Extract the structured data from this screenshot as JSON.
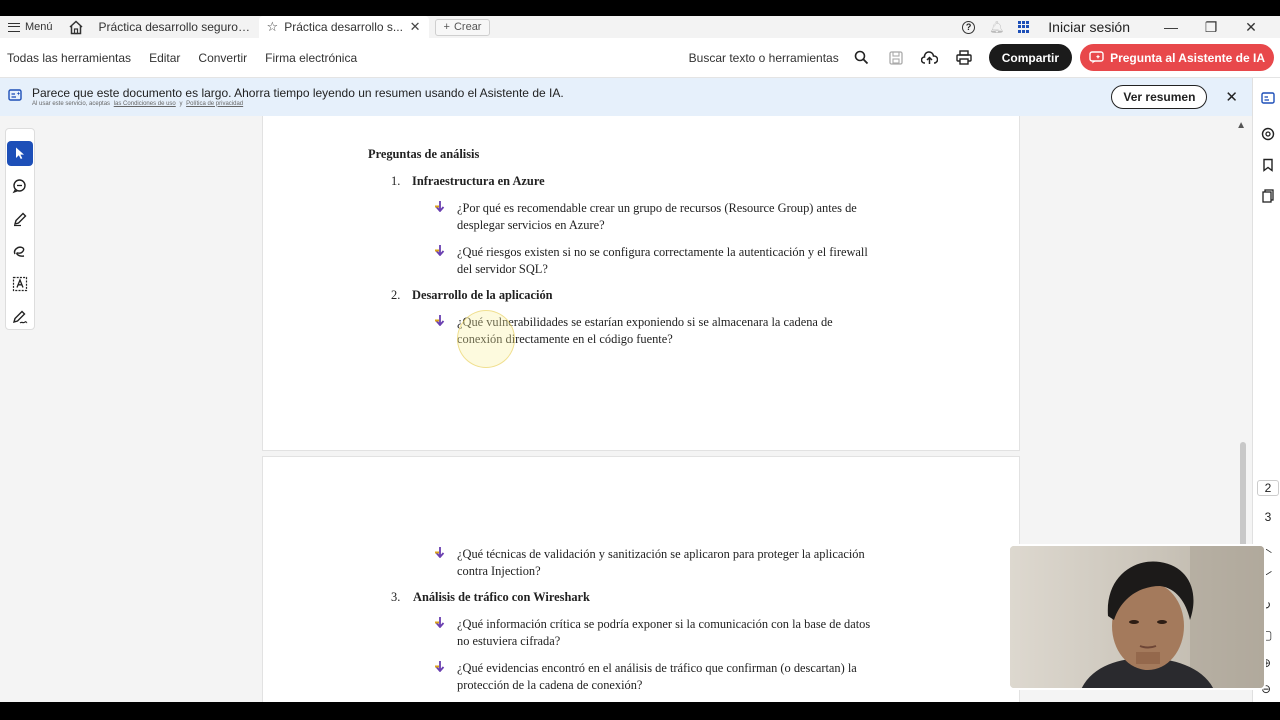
{
  "tabbar": {
    "menu_label": "Menú",
    "tabs": [
      {
        "label": "Práctica desarrollo seguro ..."
      },
      {
        "label": "Práctica desarrollo s..."
      }
    ],
    "new_tab_label": "Crear",
    "signin_label": "Iniciar sesión"
  },
  "toolbar": {
    "menu_items": [
      "Todas las herramientas",
      "Editar",
      "Convertir",
      "Firma electrónica"
    ],
    "search_label": "Buscar texto o herramientas",
    "share_label": "Compartir",
    "ai_label": "Pregunta al Asistente de IA"
  },
  "banner": {
    "message": "Parece que este documento es largo. Ahorra tiempo leyendo un resumen usando el Asistente de IA.",
    "sub_prefix": "Al usar este servicio, aceptas",
    "terms_link": "las Condiciones de uso",
    "sub_and": "y",
    "privacy_link": "Política de privacidad",
    "button_label": "Ver resumen"
  },
  "document": {
    "section_title": "Preguntas de análisis",
    "items": [
      {
        "number": "1.",
        "title": "Infraestructura en Azure",
        "questions": [
          [
            "¿Por qué es recomendable crear un grupo de recursos (Resource Group) antes de",
            "desplegar servicios en Azure?"
          ],
          [
            "¿Qué riesgos existen si no se configura correctamente la autenticación y el firewall",
            "del servidor SQL?"
          ]
        ]
      },
      {
        "number": "2.",
        "title": "Desarrollo de la aplicación",
        "questions": [
          [
            "¿Qué vulnerabilidades se estarían exponiendo si se almacenara la cadena de",
            "conexión directamente en el código fuente?"
          ]
        ]
      }
    ],
    "page2_items": [
      {
        "questions": [
          [
            "¿Qué técnicas de validación y sanitización se aplicaron para proteger la aplicación",
            "contra Injection?"
          ]
        ]
      },
      {
        "number": "3.",
        "title": "Análisis de tráfico con Wireshark",
        "questions": [
          [
            "¿Qué información crítica se podría exponer si la comunicación con la base de datos",
            "no estuviera cifrada?"
          ],
          [
            "¿Qué evidencias encontró en el análisis de tráfico que confirman (o descartan) la",
            "protección de la cadena de conexión?"
          ]
        ]
      }
    ]
  },
  "pages": {
    "current": "2",
    "next": "3"
  },
  "colors": {
    "accent": "#1d4fb8",
    "ai_button": "#e8484b",
    "share_button": "#1b1b1b",
    "banner_bg": "#e6f0fb",
    "bullet_purple": "#6a3fb0",
    "bullet_gold": "#d9a21b"
  }
}
